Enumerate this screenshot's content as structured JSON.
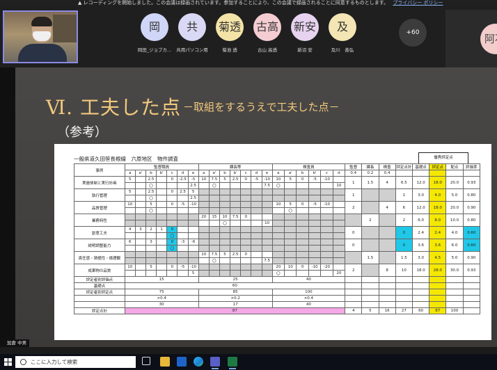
{
  "meeting": {
    "recording_notice": "レコーディングを開始しました。この会議は録画されています。参加することにより、この会議で録画されることに同意するものとします。",
    "privacy_link": "プライバシー ポリシー",
    "participants": [
      {
        "initials": "岡",
        "name": "岡田_ジョブカ... ",
        "color": "#cfd6f7"
      },
      {
        "initials": "共",
        "name": "共用パソコン用",
        "color": "#d9d9f5"
      },
      {
        "initials": "菊透",
        "name": "菊池 透",
        "color": "#f3e3a6"
      },
      {
        "initials": "古高",
        "name": "古山 高透",
        "color": "#f4cdd2"
      },
      {
        "initials": "新安",
        "name": "新沼 安",
        "color": "#e7d3ef"
      },
      {
        "initials": "及",
        "name": "及川　善弘",
        "color": "#f3e6b4"
      }
    ],
    "more_count": "+60",
    "partial_avatar": "阿石",
    "presenter_label": "加倉 中男"
  },
  "slide": {
    "title": "Ⅵ. 工夫した点",
    "subtitle": "－取組をするうえで工夫した点－",
    "reference": "（参考）"
  },
  "sheet": {
    "doc_title": "一般県道久田笹長根線　六原地区　物件調査",
    "rating_header": "優秀評定点",
    "group_headers": {
      "item": "事例",
      "a": "監督職員",
      "b": "課長等",
      "c": "検査員",
      "d": "監督",
      "e": "課長",
      "f": "検査",
      "g": "評定点計",
      "h": "基礎点",
      "i": "評定点",
      "j": "配点",
      "k": "評価率"
    },
    "sub_headers_abc": [
      "a",
      "a'",
      "b",
      "b'",
      "c",
      "d",
      "e"
    ],
    "sub_weights": [
      "0.4",
      "0.2",
      "0.4"
    ],
    "rows": [
      {
        "label": "実施体制と実行計画",
        "a": [
          "5",
          "",
          "2.5",
          "",
          "0",
          "-2.5",
          "-5"
        ],
        "a2": [
          "",
          "",
          "〇",
          "",
          "",
          "",
          "2.5"
        ],
        "b": [
          "10",
          "7.5",
          "5",
          "2.5",
          "0",
          "-5",
          "-10"
        ],
        "b2": [
          "",
          "〇",
          "",
          "",
          "",
          "",
          "7.5"
        ],
        "c": [
          "10",
          "5",
          "0",
          "-5",
          "-10",
          ""
        ],
        "c2": [
          "〇",
          "",
          "",
          "",
          "",
          "10"
        ],
        "m": [
          "1",
          "1.5",
          "4"
        ],
        "g": "6.5",
        "h": "12.0",
        "i": "18.0",
        "j": "20.0",
        "k": "0.93"
      },
      {
        "label": "執行管理",
        "a": [
          "5",
          "",
          "2.5",
          "",
          "0",
          "2.5",
          "5"
        ],
        "a2": [
          "",
          "",
          "〇",
          "",
          "",
          "",
          "2.5"
        ],
        "b": [
          "",
          "",
          "",
          "",
          "",
          "",
          ""
        ],
        "b2": [
          "",
          "",
          "",
          "",
          "",
          "",
          ""
        ],
        "c": [
          "",
          "",
          "",
          "",
          "",
          ""
        ],
        "c2": [
          "",
          "",
          "",
          "",
          "",
          ""
        ],
        "m": [
          "1",
          "",
          ""
        ],
        "g": "1",
        "h": "3.0",
        "i": "4.0",
        "j": "5.0",
        "k": "0.80"
      },
      {
        "label": "品質管理",
        "a": [
          "10",
          "",
          "5",
          "",
          "0",
          "-5",
          "-10"
        ],
        "a2": [
          "",
          "",
          "〇",
          "",
          "",
          "",
          ""
        ],
        "b": [
          "",
          "",
          "",
          "",
          "",
          "",
          ""
        ],
        "b2": [
          "",
          "",
          "",
          "",
          "",
          "",
          ""
        ],
        "c": [
          "10",
          "5",
          "0",
          "-5",
          "-10",
          ""
        ],
        "c2": [
          "",
          "〇",
          "",
          "",
          "",
          ""
        ],
        "m": [
          "2",
          "",
          "4"
        ],
        "g": "6",
        "h": "12.0",
        "i": "18.0",
        "j": "20.0",
        "k": "0.90"
      },
      {
        "label": "業務特性",
        "a": [
          "",
          "",
          "",
          "",
          "",
          "",
          ""
        ],
        "a2": [
          "",
          "",
          "",
          "",
          "",
          "",
          ""
        ],
        "b": [
          "20",
          "15",
          "10",
          "7.5",
          "0",
          "",
          ""
        ],
        "b2": [
          "",
          "",
          "〇",
          "",
          "",
          "",
          "10"
        ],
        "c": [
          "",
          "",
          "",
          "",
          "",
          ""
        ],
        "c2": [
          "",
          "",
          "",
          "",
          "",
          ""
        ],
        "m": [
          "",
          "2",
          ""
        ],
        "g": "2",
        "h": "6.0",
        "i": "8.0",
        "j": "10.0",
        "k": "0.80"
      },
      {
        "label": "創意工夫",
        "a": [
          "4",
          "3",
          "2",
          "1",
          "0",
          "",
          ""
        ],
        "a2": [
          "",
          "",
          "",
          "",
          "〇",
          "",
          ""
        ],
        "b": [
          "",
          "",
          "",
          "",
          "",
          "",
          ""
        ],
        "b2": [
          "",
          "",
          "",
          "",
          "",
          "",
          ""
        ],
        "c": [
          "",
          "",
          "",
          "",
          "",
          ""
        ],
        "c2": [
          "",
          "",
          "",
          "",
          "",
          ""
        ],
        "m": [
          "0",
          "",
          ""
        ],
        "g": "0",
        "h": "2.4",
        "i": "2.4",
        "j": "4.0",
        "k": "0.60"
      },
      {
        "label": "説明調整能力",
        "a": [
          "6",
          "",
          "3",
          "",
          "0",
          "-3",
          "-6"
        ],
        "a2": [
          "",
          "",
          "",
          "",
          "〇",
          "",
          ""
        ],
        "b": [
          "",
          "",
          "",
          "",
          "",
          "",
          ""
        ],
        "b2": [
          "",
          "",
          "",
          "",
          "",
          "",
          ""
        ],
        "c": [
          "",
          "",
          "",
          "",
          "",
          ""
        ],
        "c2": [
          "",
          "",
          "",
          "",
          "",
          ""
        ],
        "m": [
          "0",
          "",
          ""
        ],
        "g": "0",
        "h": "3.6",
        "i": "3.6",
        "j": "6.0",
        "k": "0.60"
      },
      {
        "label": "責任感・積極性・倫理観",
        "a": [
          "",
          "",
          "",
          "",
          "",
          "",
          ""
        ],
        "a2": [
          "",
          "",
          "",
          "",
          "",
          "",
          ""
        ],
        "b": [
          "10",
          "7.5",
          "5",
          "2.5",
          "0",
          "",
          ""
        ],
        "b2": [
          "",
          "〇",
          "",
          "",
          "",
          "",
          "7.5"
        ],
        "c": [
          "",
          "",
          "",
          "",
          "",
          ""
        ],
        "c2": [
          "",
          "",
          "",
          "",
          "",
          ""
        ],
        "m": [
          "",
          "1.5",
          ""
        ],
        "g": "1.5",
        "h": "3.0",
        "i": "4.5",
        "j": "5.0",
        "k": "0.90"
      },
      {
        "label": "成果物の品質",
        "a": [
          "10",
          "",
          "5",
          "",
          "0",
          "-5",
          "-10"
        ],
        "a2": [
          "",
          "",
          "",
          "",
          "",
          "",
          "5"
        ],
        "b": [
          "",
          "",
          "",
          "",
          "",
          "",
          ""
        ],
        "b2": [
          "",
          "",
          "",
          "",
          "",
          "",
          ""
        ],
        "c": [
          "20",
          "10",
          "0",
          "-10",
          "-20",
          ""
        ],
        "c2": [
          "〇",
          "",
          "",
          "",
          "",
          "20"
        ],
        "m": [
          "2",
          "",
          "8"
        ],
        "g": "10",
        "h": "18.0",
        "i": "28.0",
        "j": "30.0",
        "k": "0.93"
      }
    ],
    "summary": {
      "scores_label": "評定者別評価点",
      "scores": [
        "15",
        "25",
        "40"
      ],
      "base_label": "基礎点",
      "base": "60",
      "rating_label": "評定者別評定点",
      "ratings": [
        "75",
        "85",
        "100"
      ],
      "weights": [
        "×0.4",
        "×0.2",
        "×0.4"
      ],
      "weighted": [
        "30",
        "17",
        "40"
      ],
      "total_label": "評定点計",
      "total": "87",
      "total_tail": [
        "4",
        "5",
        "16",
        "27",
        "60",
        "87",
        "100"
      ]
    }
  },
  "taskbar": {
    "search_placeholder": "ここに入力して検索"
  }
}
